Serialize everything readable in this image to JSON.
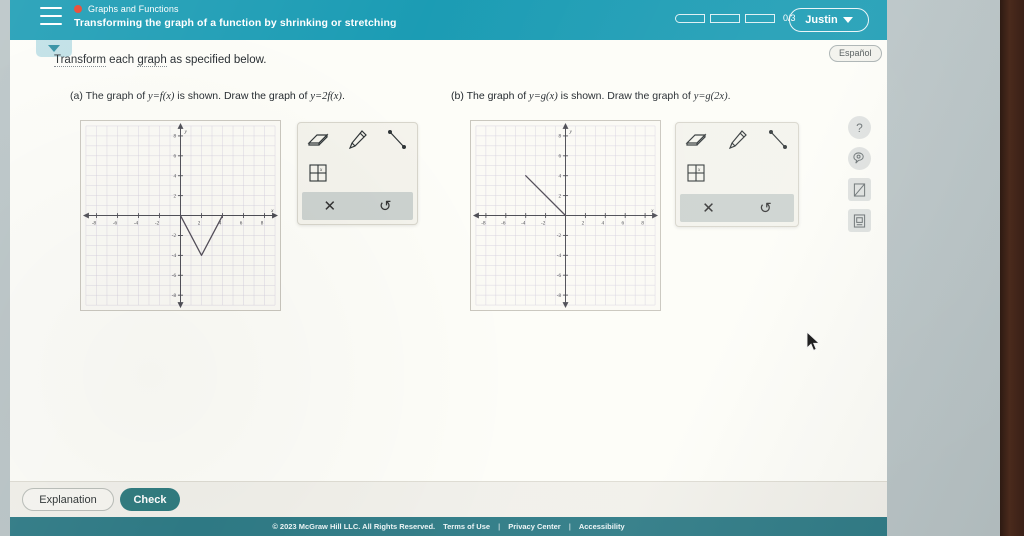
{
  "header": {
    "topic": "Graphs and Functions",
    "lesson_title": "Transforming the graph of a function by shrinking or stretching",
    "progress_count": "0/3",
    "progress_segments": 3,
    "progress_filled": 0,
    "user_name": "Justin",
    "menu_icon": "hamburger-icon",
    "topic_dot_color": "#e8442e",
    "bar_color": "#1b9cb4"
  },
  "subheader": {
    "collapse_icon": "chevron-down-icon",
    "espanol_label": "Español"
  },
  "instruction": {
    "word_transform": "Transform",
    "mid": " each ",
    "word_graph": "graph",
    "tail": " as specified below."
  },
  "parts": [
    {
      "id": "a",
      "marker": "(a)",
      "text_1": "The graph of ",
      "fn_shown": "y=f(x)",
      "text_2": " is shown. Draw the graph of ",
      "fn_draw": "y=2f(x)",
      "text_3": "."
    },
    {
      "id": "b",
      "marker": "(b)",
      "text_1": "The graph of ",
      "fn_shown": "y=g(x)",
      "text_2": " is shown. Draw the graph of ",
      "fn_draw": "y=g(2x)",
      "text_3": "."
    }
  ],
  "toolbar": {
    "tools": [
      {
        "name": "eraser-icon",
        "label": "Eraser"
      },
      {
        "name": "pencil-icon",
        "label": "Draw"
      },
      {
        "name": "line-segment-icon",
        "label": "Line segment"
      },
      {
        "name": "graph-grid-icon",
        "label": "Plot on grid"
      }
    ],
    "actions": [
      {
        "name": "clear-icon",
        "glyph": "✕",
        "label": "Clear"
      },
      {
        "name": "undo-icon",
        "glyph": "↺",
        "label": "Undo"
      }
    ]
  },
  "right_rail": [
    {
      "name": "help-icon",
      "glyph": "?",
      "label": "Help"
    },
    {
      "name": "ask-tutor-icon",
      "glyph": "◔",
      "label": "Ask tutor"
    },
    {
      "name": "calculator-icon",
      "glyph": "▤",
      "label": "Calculator"
    },
    {
      "name": "reference-icon",
      "glyph": "▥",
      "label": "Reference"
    }
  ],
  "footer_buttons": {
    "explanation": "Explanation",
    "check": "Check"
  },
  "footer": {
    "copyright": "© 2023 McGraw Hill LLC. All Rights Reserved.",
    "links": [
      "Terms of Use",
      "Privacy Center",
      "Accessibility"
    ],
    "separator": "|"
  },
  "chart_data": [
    {
      "id": "graph-a",
      "type": "line",
      "title": "Graph of y=f(x)",
      "xlabel": "x",
      "ylabel": "y",
      "xlim": [
        -9,
        9
      ],
      "ylim": [
        -9,
        9
      ],
      "xticks": [
        -8,
        -6,
        -4,
        -2,
        2,
        4,
        6,
        8
      ],
      "yticks": [
        8,
        6,
        4,
        2,
        -2,
        -4,
        -6,
        -8
      ],
      "grid": true,
      "grid_step": 1,
      "series": [
        {
          "name": "f(x)",
          "points": [
            [
              0,
              0
            ],
            [
              2,
              -4
            ],
            [
              4,
              0
            ]
          ]
        }
      ]
    },
    {
      "id": "graph-b",
      "type": "line",
      "title": "Graph of y=g(x)",
      "xlabel": "x",
      "ylabel": "y",
      "xlim": [
        -9,
        9
      ],
      "ylim": [
        -9,
        9
      ],
      "xticks": [
        -8,
        -6,
        -4,
        -2,
        2,
        4,
        6,
        8
      ],
      "yticks": [
        8,
        6,
        4,
        2,
        -2,
        -4,
        -6,
        -8
      ],
      "grid": true,
      "grid_step": 1,
      "series": [
        {
          "name": "g(x)",
          "points": [
            [
              -4,
              4
            ],
            [
              0,
              0
            ]
          ]
        }
      ]
    }
  ]
}
